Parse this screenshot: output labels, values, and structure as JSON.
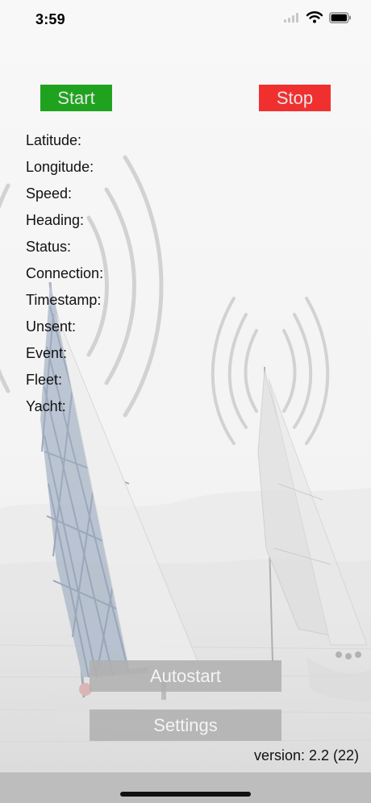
{
  "status_bar": {
    "time": "3:59",
    "icons": [
      "signal-icon",
      "wifi-icon",
      "battery-icon"
    ]
  },
  "controls": {
    "start_label": "Start",
    "stop_label": "Stop",
    "start_color": "#1fa31f",
    "stop_color": "#f0302f"
  },
  "info": {
    "fields": [
      {
        "key": "latitude",
        "label": "Latitude:",
        "value": ""
      },
      {
        "key": "longitude",
        "label": "Longitude:",
        "value": ""
      },
      {
        "key": "speed",
        "label": "Speed:",
        "value": ""
      },
      {
        "key": "heading",
        "label": "Heading:",
        "value": ""
      },
      {
        "key": "status",
        "label": "Status:",
        "value": ""
      },
      {
        "key": "connection",
        "label": "Connection:",
        "value": ""
      },
      {
        "key": "timestamp",
        "label": "Timestamp:",
        "value": ""
      },
      {
        "key": "unsent",
        "label": "Unsent:",
        "value": ""
      },
      {
        "key": "event",
        "label": "Event:",
        "value": ""
      },
      {
        "key": "fleet",
        "label": "Fleet:",
        "value": ""
      },
      {
        "key": "yacht",
        "label": "Yacht:",
        "value": ""
      }
    ]
  },
  "actions": {
    "autostart_label": "Autostart",
    "settings_label": "Settings"
  },
  "footer": {
    "version": "version: 2.2 (22)"
  }
}
